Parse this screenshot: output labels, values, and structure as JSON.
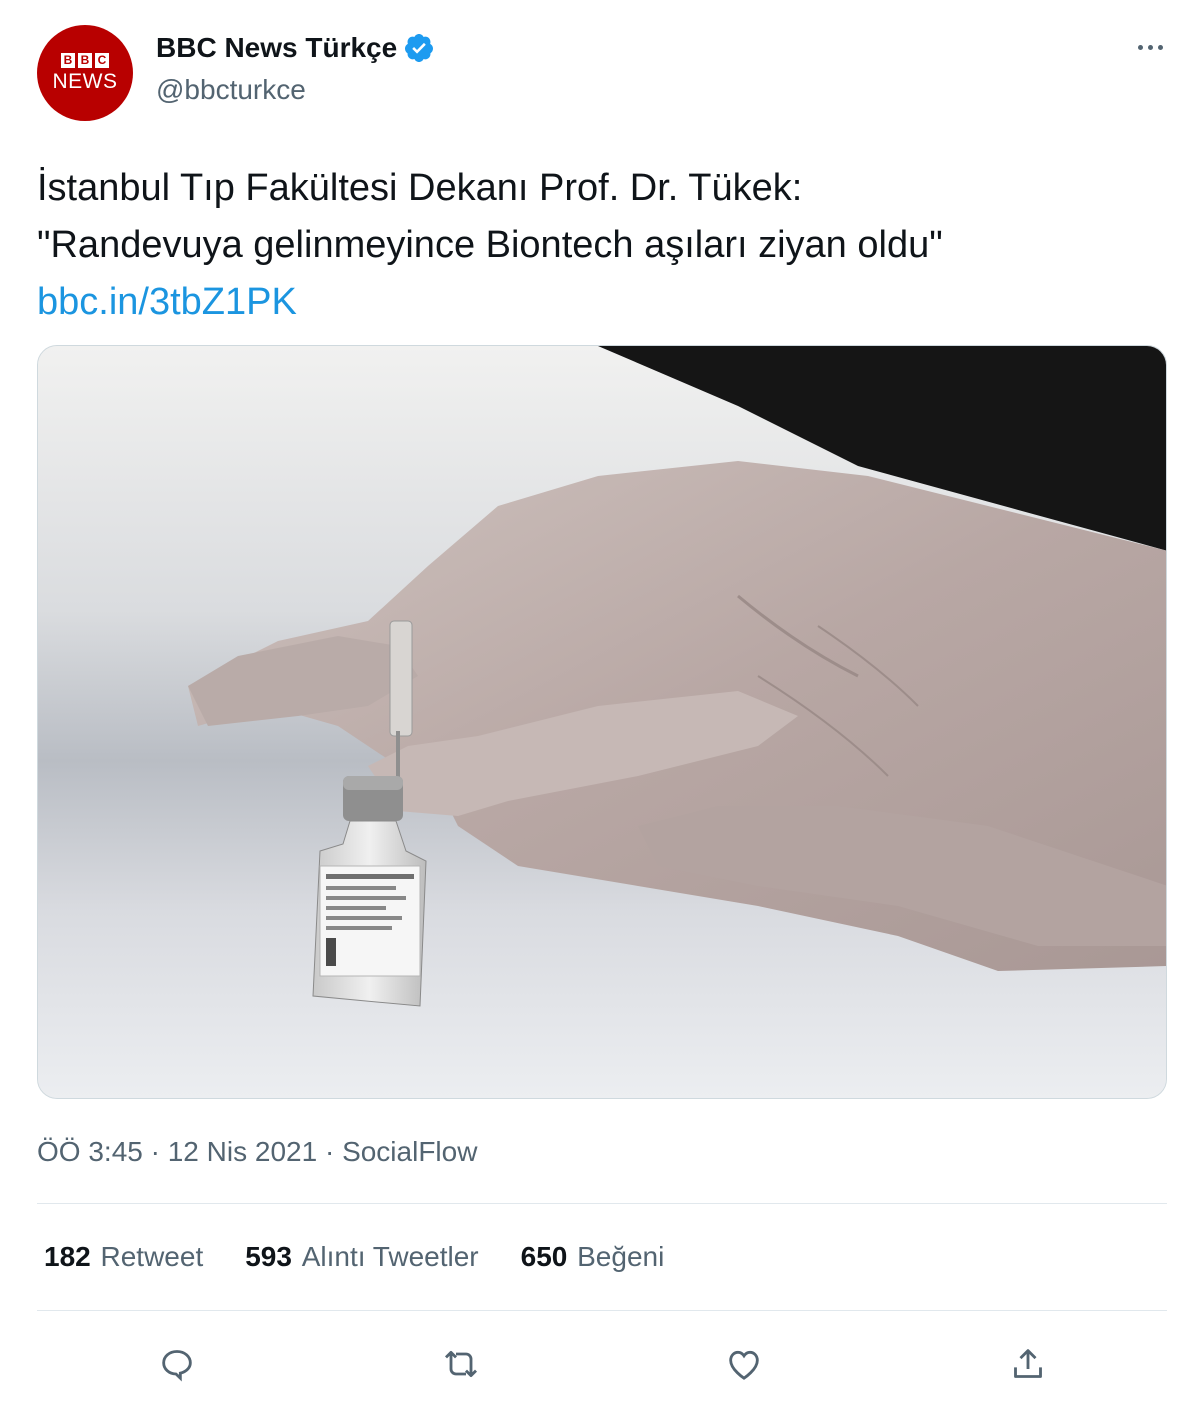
{
  "author": {
    "display_name": "BBC News Türkçe",
    "handle": "@bbcturkce",
    "avatar_blocks": [
      "B",
      "B",
      "C"
    ],
    "avatar_word": "NEWS",
    "verified": true
  },
  "tweet": {
    "line1": "İstanbul Tıp Fakültesi Dekanı Prof. Dr. Tükek:",
    "line2": "\"Randevuya gelinmeyince Biontech aşıları ziyan oldu\"",
    "link": "bbc.in/3tbZ1PK"
  },
  "meta": {
    "time": "ÖÖ 3:45",
    "separator": "·",
    "date": "12 Nis 2021",
    "source": "SocialFlow"
  },
  "stats": {
    "retweets": {
      "count": "182",
      "label": "Retweet"
    },
    "quotes": {
      "count": "593",
      "label": "Alıntı Tweetler"
    },
    "likes": {
      "count": "650",
      "label": "Beğeni"
    }
  },
  "icons": {
    "more": "more-dots-icon",
    "verified": "verified-badge-icon",
    "reply": "reply-icon",
    "retweet": "retweet-icon",
    "like": "heart-icon",
    "share": "share-icon"
  },
  "colors": {
    "link": "#1b95e0",
    "verified": "#1d9bf0",
    "bbc_red": "#b80000",
    "secondary_text": "#536471",
    "icon": "#536471"
  }
}
